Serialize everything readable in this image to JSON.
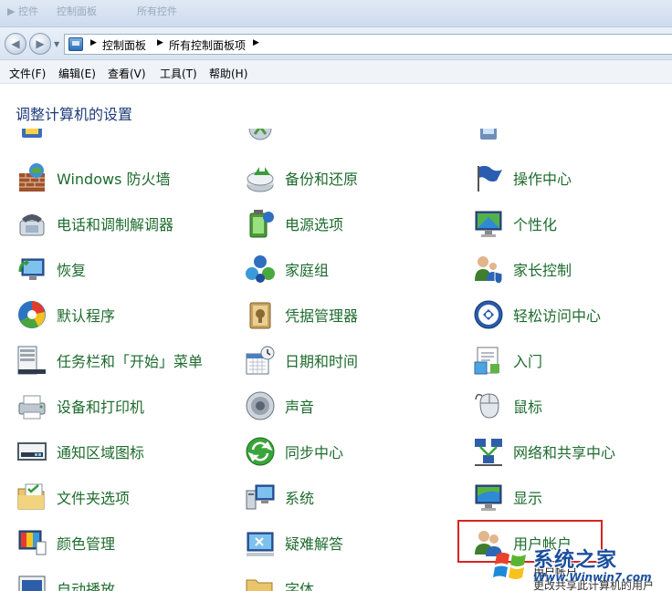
{
  "titlebar": {
    "ghost_items": [
      "▶ 控件",
      "控制面板",
      "所有控件"
    ]
  },
  "address": {
    "crumbs": [
      "控制面板",
      "所有控制面板项"
    ]
  },
  "menu": {
    "items": [
      "文件(F)",
      "编辑(E)",
      "查看(V)",
      "工具(T)",
      "帮助(H)"
    ]
  },
  "page": {
    "heading": "调整计算机的设置"
  },
  "items": [
    {
      "label": "Windows 防火墙",
      "icon": "firewall-icon"
    },
    {
      "label": "备份和还原",
      "icon": "backup-icon"
    },
    {
      "label": "操作中心",
      "icon": "action-center-flag-icon"
    },
    {
      "label": "电话和调制解调器",
      "icon": "phone-modem-icon"
    },
    {
      "label": "电源选项",
      "icon": "power-options-icon"
    },
    {
      "label": "个性化",
      "icon": "personalization-icon"
    },
    {
      "label": "恢复",
      "icon": "recovery-icon"
    },
    {
      "label": "家庭组",
      "icon": "homegroup-icon"
    },
    {
      "label": "家长控制",
      "icon": "parental-controls-icon"
    },
    {
      "label": "默认程序",
      "icon": "default-programs-icon"
    },
    {
      "label": "凭据管理器",
      "icon": "credential-manager-icon"
    },
    {
      "label": "轻松访问中心",
      "icon": "ease-of-access-icon"
    },
    {
      "label": "任务栏和「开始」菜单",
      "icon": "taskbar-icon"
    },
    {
      "label": "日期和时间",
      "icon": "date-time-icon"
    },
    {
      "label": "入门",
      "icon": "getting-started-icon"
    },
    {
      "label": "设备和打印机",
      "icon": "devices-printers-icon"
    },
    {
      "label": "声音",
      "icon": "sound-icon"
    },
    {
      "label": "鼠标",
      "icon": "mouse-icon"
    },
    {
      "label": "通知区域图标",
      "icon": "notification-area-icon"
    },
    {
      "label": "同步中心",
      "icon": "sync-center-icon"
    },
    {
      "label": "网络和共享中心",
      "icon": "network-sharing-icon"
    },
    {
      "label": "文件夹选项",
      "icon": "folder-options-icon"
    },
    {
      "label": "系统",
      "icon": "system-icon"
    },
    {
      "label": "显示",
      "icon": "display-icon"
    },
    {
      "label": "颜色管理",
      "icon": "color-management-icon"
    },
    {
      "label": "疑难解答",
      "icon": "troubleshooting-icon"
    },
    {
      "label": "用户帐户",
      "icon": "user-accounts-icon"
    },
    {
      "label": "自动播放",
      "icon": "autoplay-icon"
    },
    {
      "label": "字体",
      "icon": "fonts-icon"
    }
  ],
  "tooltip": {
    "title": "用户帐户",
    "desc": "更改共享此计算机的用户"
  },
  "watermark": {
    "title": "系统之家",
    "url": "Www.Winwin7.com"
  },
  "colors": {
    "link": "#1d6b2d",
    "heading": "#1e3c7a",
    "highlight": "#d9231f"
  }
}
